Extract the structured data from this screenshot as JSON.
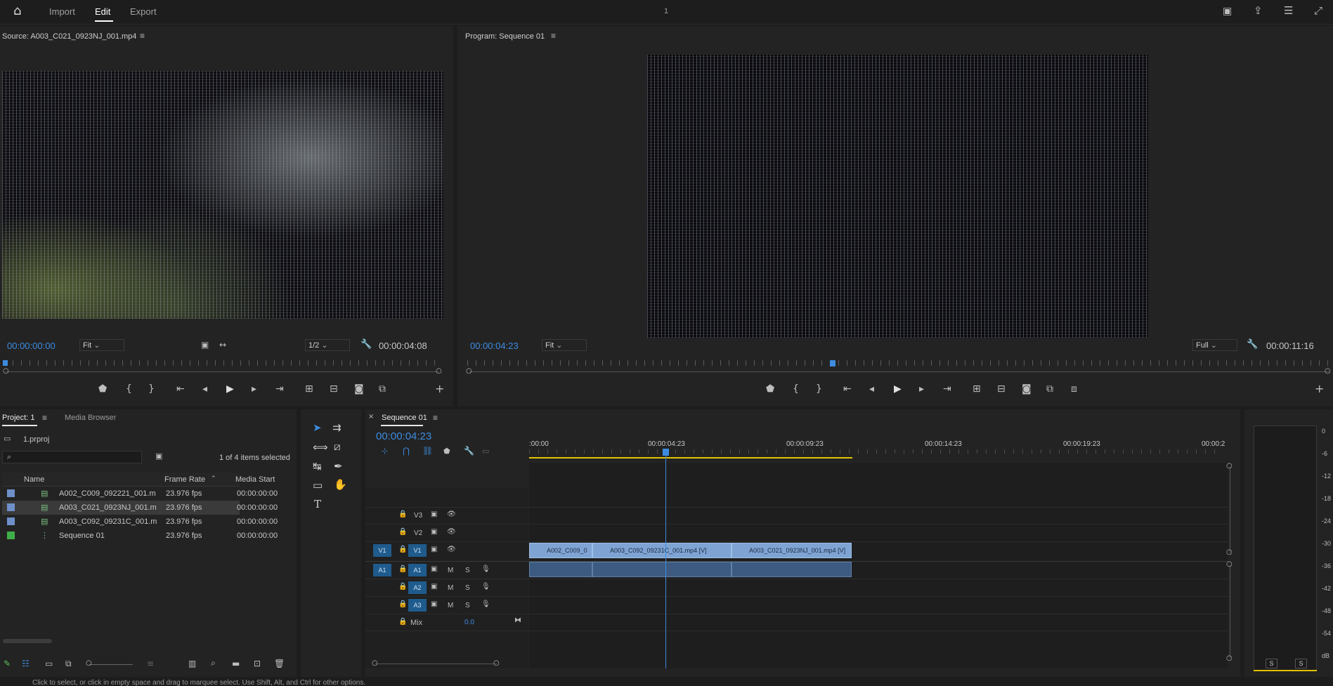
{
  "topbar": {
    "home_icon": "home-icon",
    "tabs": [
      {
        "label": "Import",
        "active": false
      },
      {
        "label": "Edit",
        "active": true
      },
      {
        "label": "Export",
        "active": false
      }
    ],
    "center_badge": "1",
    "right_icons": [
      "quick-export-icon",
      "share-icon",
      "workspaces-icon",
      "fullscreen-icon"
    ]
  },
  "source_monitor": {
    "title": "Source: A003_C021_0923NJ_001.mp4",
    "timecode_in": "00:00:00:00",
    "fit": "Fit",
    "resolution": "1/2",
    "duration": "00:00:04:08"
  },
  "program_monitor": {
    "title": "Program: Sequence 01",
    "timecode_in": "00:00:04:23",
    "fit": "Fit",
    "resolution": "Full",
    "duration": "00:00:11:16"
  },
  "project_panel": {
    "tab_project": "Project: 1",
    "tab_media_browser": "Media Browser",
    "project_file": "1.prproj",
    "selection_status": "1 of 4 items selected",
    "columns": [
      "Name",
      "Frame Rate",
      "Media Start"
    ],
    "rows": [
      {
        "name": "A002_C009_092221_001.m",
        "fps": "23.976 fps",
        "start": "00:00:00:00",
        "color": "#6e8fc8",
        "selected": false
      },
      {
        "name": "A003_C021_0923NJ_001.m",
        "fps": "23.976 fps",
        "start": "00:00:00:00",
        "color": "#6e8fc8",
        "selected": true
      },
      {
        "name": "A003_C092_09231C_001.m",
        "fps": "23.976 fps",
        "start": "00:00:00:00",
        "color": "#6e8fc8",
        "selected": false
      },
      {
        "name": "Sequence 01",
        "fps": "23.976 fps",
        "start": "00:00:00:00",
        "color": "#3fae49",
        "selected": false
      }
    ]
  },
  "timeline": {
    "tab": "Sequence 01",
    "timecode": "00:00:04:23",
    "ruler": [
      ":00:00",
      "00:00:04:23",
      "00:00:09:23",
      "00:00:14:23",
      "00:00:19:23",
      "00:00:2"
    ],
    "tracks": {
      "v3": "V3",
      "v2": "V2",
      "v1": "V1",
      "a1": "A1",
      "a2": "A2",
      "a3": "A3",
      "m": "M",
      "s": "S",
      "mix": "Mix",
      "mix_value": "0.0"
    },
    "clips": [
      {
        "label": "A002_C009_0"
      },
      {
        "label": "A003_C092_09231C_001.mp4 [V]"
      },
      {
        "label": "A003_C021_0923NJ_001.mp4 [V]"
      }
    ]
  },
  "audio_meter": {
    "ticks": [
      "0",
      "-6",
      "-12",
      "-18",
      "-24",
      "-30",
      "-36",
      "-42",
      "-48",
      "-54",
      "dB"
    ],
    "solo_left": "S",
    "solo_right": "S"
  },
  "status_bar": {
    "text": "Click to select, or click in empty space and drag to marquee select. Use Shift, Alt, and Ctrl for other options."
  },
  "colors": {
    "accent": "#3d8ce0",
    "clip_video": "#7fa4d4",
    "clip_audio": "#3d5b80",
    "work_area": "#e2c400"
  }
}
